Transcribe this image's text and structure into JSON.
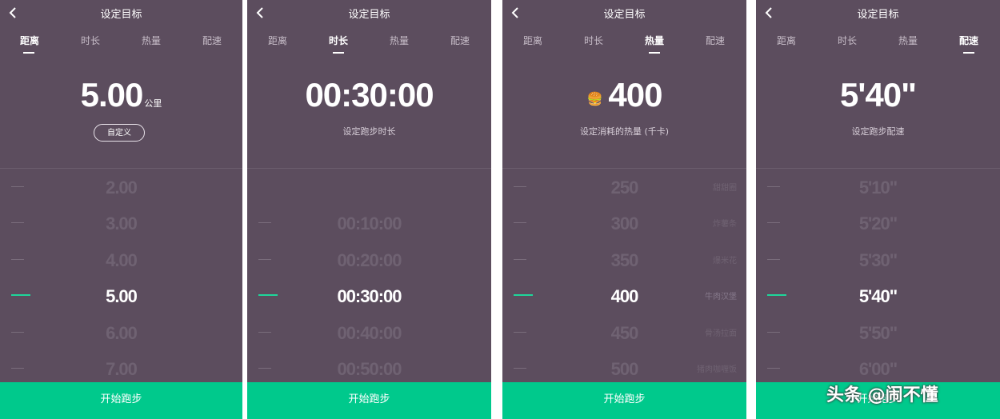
{
  "header_title": "设定目标",
  "tabs": [
    "距离",
    "时长",
    "热量",
    "配速"
  ],
  "start_button": "开始跑步",
  "watermark": "头条 @闹不懂",
  "colors": {
    "panel_bg": "#5c4d5e",
    "accent_green": "#00c98c",
    "active_tick": "#1ed69a"
  },
  "icons": {
    "back": "chevron-left-icon",
    "calorie": "burger-icon"
  },
  "panels": [
    {
      "active_tab": "距离",
      "value": "5.00",
      "unit": "公里",
      "custom_button": "自定义",
      "picker": [
        "2.00",
        "3.00",
        "4.00",
        "5.00",
        "6.00",
        "7.00"
      ],
      "selected": "5.00"
    },
    {
      "active_tab": "时长",
      "value": "00:30:00",
      "subtitle": "设定跑步时长",
      "picker": [
        "",
        "00:10:00",
        "00:20:00",
        "00:30:00",
        "00:40:00",
        "00:50:00"
      ],
      "selected": "00:30:00"
    },
    {
      "active_tab": "热量",
      "value": "400",
      "subtitle": "设定消耗的热量 (千卡)",
      "picker": [
        "250",
        "300",
        "350",
        "400",
        "450",
        "500"
      ],
      "food_labels": [
        "甜甜圈",
        "炸薯条",
        "爆米花",
        "牛肉汉堡",
        "骨汤拉面",
        "猪肉咖喱饭"
      ],
      "selected": "400"
    },
    {
      "active_tab": "配速",
      "value": "5'40\"",
      "subtitle": "设定跑步配速",
      "picker": [
        "5'10\"",
        "5'20\"",
        "5'30\"",
        "5'40\"",
        "5'50\"",
        "6'00\""
      ],
      "selected": "5'40\""
    }
  ]
}
